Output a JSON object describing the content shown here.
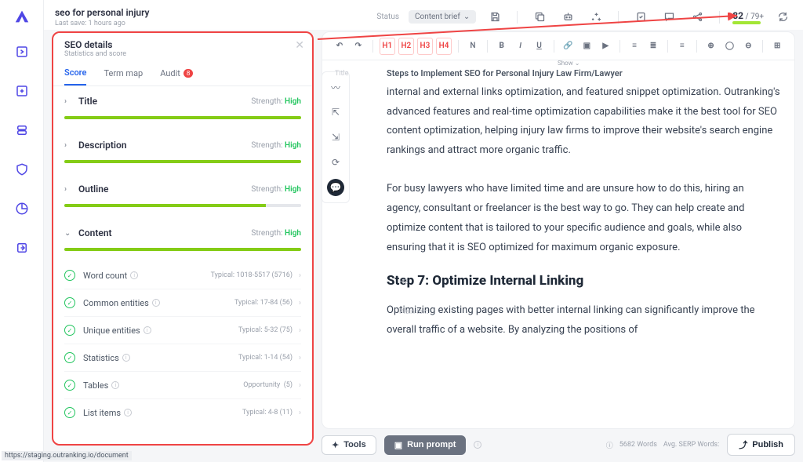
{
  "header": {
    "title": "seo for personal injury",
    "last_save": "Last save: 1 hours ago",
    "status_label": "Status",
    "status_value": "Content brief",
    "score": "82",
    "score_target": "79+"
  },
  "panel": {
    "title": "SEO details",
    "subtitle": "Statistics and score",
    "tabs": {
      "score": "Score",
      "termmap": "Term map",
      "audit": "Audit",
      "audit_badge": "8"
    },
    "strength_label": "Strength:",
    "strength_high": "High",
    "opportunity_label": "Opportunity",
    "sections": {
      "title": "Title",
      "description": "Description",
      "outline": "Outline",
      "content": "Content"
    },
    "items": {
      "wordcount": {
        "name": "Word count",
        "meta": "Typical: 1018-5517  (5716)"
      },
      "common": {
        "name": "Common entities",
        "meta": "Typical: 17-84  (56)"
      },
      "unique": {
        "name": "Unique entities",
        "meta": "Typical: 5-32  (75)"
      },
      "stats": {
        "name": "Statistics",
        "meta": "Typical: 1-14  (54)"
      },
      "tables": {
        "name": "Tables",
        "meta": "(5)"
      },
      "lists": {
        "name": "List items",
        "meta": "Typical: 4-8  (11)"
      }
    }
  },
  "article": {
    "title_label": "Title",
    "title": "Steps to Implement SEO for Personal Injury Law Firm/Lawyer",
    "show": "Show ⌄",
    "h3_label": "H3",
    "plain_label": "Plain text",
    "p1": "internal and external links optimization, and featured snippet optimization. Outranking's advanced features and real-time optimization capabilities make it the best tool for SEO content optimization, helping injury law firms to improve their website's search engine rankings and attract more organic traffic.",
    "p2": "For busy lawyers who have limited time and are unsure how to do this, hiring an agency, consultant or freelancer is the best way to go. They can help create and optimize content that is tailored to your specific audience and goals, while also ensuring that it is SEO optimized for maximum organic exposure.",
    "h3": "Step 7: Optimize Internal Linking",
    "p3": "Optimizing existing pages with better internal linking can significantly improve the overall traffic of a website. By analyzing the positions of"
  },
  "footer": {
    "tools": "Tools",
    "run": "Run prompt",
    "words": "5682 Words",
    "serp": "Avg. SERP Words:",
    "publish": "Publish"
  },
  "status_url": "https://staging.outranking.io/document"
}
